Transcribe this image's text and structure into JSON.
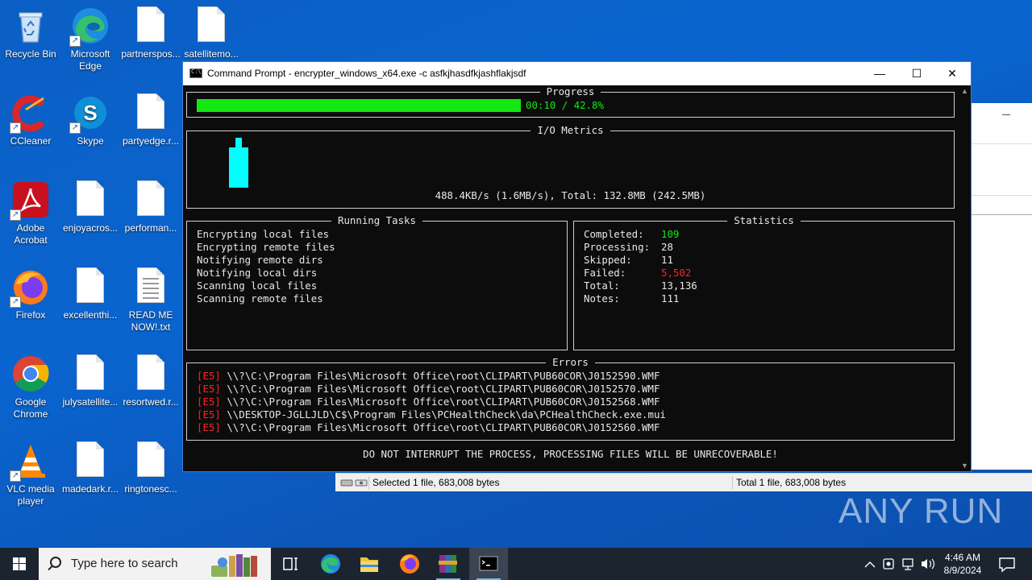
{
  "desktop": {
    "icons": [
      {
        "label": "Recycle Bin"
      },
      {
        "label": "Microsoft Edge"
      },
      {
        "label": "partnerspos..."
      },
      {
        "label": "satellitemo..."
      },
      {
        "label": "CCleaner"
      },
      {
        "label": "Skype"
      },
      {
        "label": "partyedge.r..."
      },
      {
        "label": "Adobe Acrobat"
      },
      {
        "label": "enjoyacros..."
      },
      {
        "label": "performan..."
      },
      {
        "label": "Firefox"
      },
      {
        "label": "excellenthi..."
      },
      {
        "label": "READ ME NOW!.txt"
      },
      {
        "label": "Google Chrome"
      },
      {
        "label": "julysatellite..."
      },
      {
        "label": "resortwed.r..."
      },
      {
        "label": "VLC media player"
      },
      {
        "label": "madedark.r..."
      },
      {
        "label": "ringtonesc..."
      }
    ]
  },
  "cmd": {
    "title": "Command Prompt - encrypter_windows_x64.exe  -c asfkjhasdfkjashflakjsdf",
    "controls": {
      "minimize": "—",
      "maximize": "☐",
      "close": "✕"
    },
    "progress": {
      "title": "Progress",
      "text": "00:10 / 42.8%",
      "fraction": 0.428,
      "color": "#13e813"
    },
    "io": {
      "title": "I/O Metrics",
      "text": "488.4KB/s (1.6MB/s), Total: 132.8MB (242.5MB)",
      "bar_color": "#00ffff"
    },
    "tasks": {
      "title": "Running Tasks",
      "items": [
        "Encrypting local files",
        "Encrypting remote files",
        "Notifying remote dirs",
        "Notifying local dirs",
        "Scanning local files",
        "Scanning remote files"
      ]
    },
    "stats": {
      "title": "Statistics",
      "rows": [
        {
          "label": "Completed:",
          "value": "109"
        },
        {
          "label": "Processing:",
          "value": "28"
        },
        {
          "label": "Skipped:",
          "value": "11"
        },
        {
          "label": "Failed:",
          "value": "5,502"
        },
        {
          "label": "Total:",
          "value": "13,136"
        },
        {
          "label": "Notes:",
          "value": "111"
        }
      ]
    },
    "errors": {
      "title": "Errors",
      "items": [
        {
          "code": "[E5]",
          "path": "\\\\?\\C:\\Program Files\\Microsoft Office\\root\\CLIPART\\PUB60COR\\J0152590.WMF"
        },
        {
          "code": "[E5]",
          "path": "\\\\?\\C:\\Program Files\\Microsoft Office\\root\\CLIPART\\PUB60COR\\J0152570.WMF"
        },
        {
          "code": "[E5]",
          "path": "\\\\?\\C:\\Program Files\\Microsoft Office\\root\\CLIPART\\PUB60COR\\J0152568.WMF"
        },
        {
          "code": "[E5]",
          "path": "\\\\DESKTOP-JGLLJLD\\C$\\Program Files\\PCHealthCheck\\da\\PCHealthCheck.exe.mui"
        },
        {
          "code": "[E5]",
          "path": "\\\\?\\C:\\Program Files\\Microsoft Office\\root\\CLIPART\\PUB60COR\\J0152560.WMF"
        }
      ]
    },
    "warning": "DO NOT INTERRUPT THE PROCESS, PROCESSING FILES WILL BE UNRECOVERABLE!"
  },
  "explorer_status": {
    "selected": "Selected 1 file, 683,008 bytes",
    "total": "Total 1 file, 683,008 bytes"
  },
  "taskbar": {
    "search_placeholder": "Type here to search",
    "time": "4:46 AM",
    "date": "8/9/2024"
  },
  "watermark": "ANY RUN"
}
